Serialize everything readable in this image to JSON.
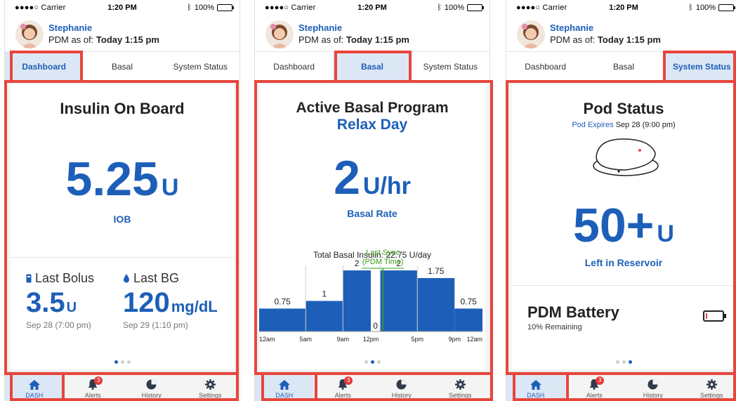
{
  "status_bar": {
    "carrier": "●●●●○ Carrier",
    "time": "1:20 PM",
    "battery": "100%"
  },
  "user": {
    "name": "Stephanie",
    "pdm_prefix": "PDM as of: ",
    "pdm_time": "Today 1:15 pm"
  },
  "tabs": [
    "Dashboard",
    "Basal",
    "System Status"
  ],
  "nav": {
    "dash": "DASH",
    "alerts": "Alerts",
    "alerts_badge": "3",
    "history": "History",
    "settings": "Settings"
  },
  "screens": {
    "iob": {
      "title": "Insulin On Board",
      "value": "5.25",
      "unit": "U",
      "label": "IOB",
      "last_bolus_label": "Last Bolus",
      "last_bolus_value": "3.5",
      "last_bolus_unit": "U",
      "last_bolus_date": "Sep 28 (7:00 pm)",
      "last_bg_label": "Last BG",
      "last_bg_value": "120",
      "last_bg_unit": "mg/dL",
      "last_bg_date": "Sep 29 (1:10 pm)"
    },
    "basal": {
      "title": "Active Basal Program",
      "program": "Relax Day",
      "value": "2",
      "unit": "U/hr",
      "label": "Basal Rate",
      "total": "Total Basal Insulin: 22.75 U/day",
      "sync_line1": "Last Sync",
      "sync_line2": "(PDM Time)"
    },
    "pod": {
      "title": "Pod Status",
      "expires_label": "Pod Expires",
      "expires_value": "Sep 28 (9:00 pm)",
      "value": "50+",
      "unit": "U",
      "label": "Left in Reservoir",
      "battery_title": "PDM Battery",
      "battery_sub": "10% Remaining",
      "battery_level": 0.1
    }
  },
  "chart_data": {
    "type": "bar",
    "title": "",
    "xlabel": "",
    "ylabel": "",
    "segments": [
      {
        "start": 0,
        "end": 5,
        "value": 0.75
      },
      {
        "start": 5,
        "end": 9,
        "value": 1
      },
      {
        "start": 9,
        "end": 12,
        "value": 2
      },
      {
        "start": 12,
        "end": 13,
        "value": 0
      },
      {
        "start": 13,
        "end": 17,
        "value": 2
      },
      {
        "start": 17,
        "end": 21,
        "value": 1.75
      },
      {
        "start": 21,
        "end": 24,
        "value": 0.75
      }
    ],
    "x_ticks": [
      "12am",
      "5am",
      "9am",
      "12pm",
      "5pm",
      "9pm",
      "12am"
    ],
    "x_tick_hours": [
      0,
      5,
      9,
      12,
      17,
      21,
      24
    ],
    "sync_hour": 13.3,
    "ylim": [
      0,
      2.3
    ],
    "colors": {
      "bar": "#1d5fb8",
      "sync": "#3aa11d"
    }
  },
  "colors": {
    "accent": "#1d5fb8",
    "highlight": "#e8453c",
    "active_bg": "#dce7f5"
  }
}
